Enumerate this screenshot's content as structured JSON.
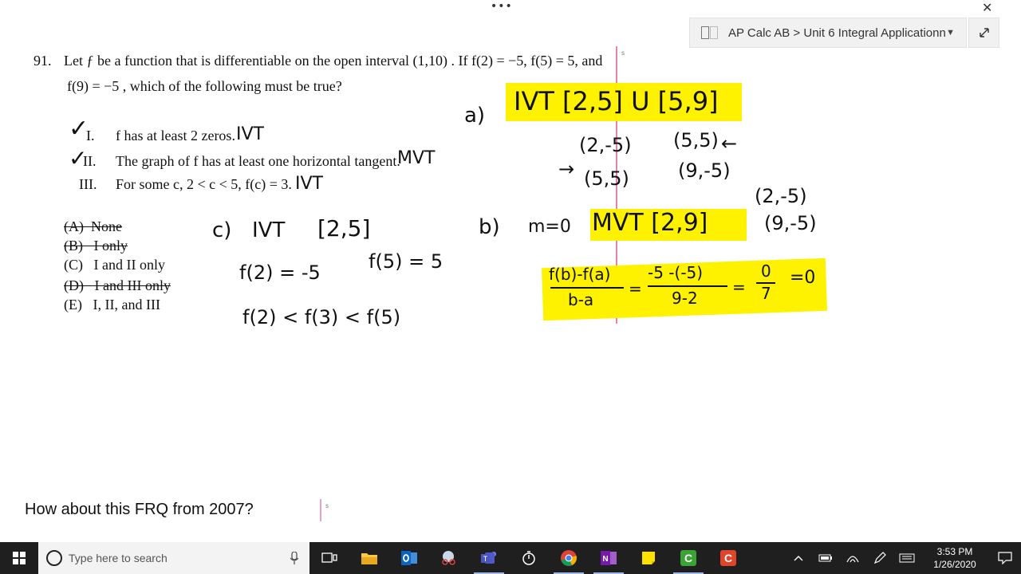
{
  "window": {
    "menu_dots": "•••",
    "close": "✕",
    "notebook_path": "AP Calc AB > Unit 6 Integral Applicationn",
    "margin_mark": "s"
  },
  "problem": {
    "number": "91.",
    "line1": "Let ƒ be a function that is differentiable on the open interval (1,10) . If f(2) = −5, f(5) = 5, and",
    "line2": "f(9) = −5 , which of the following must be true?",
    "statements": [
      {
        "check": "✓",
        "numeral": "I.",
        "text": "f has at least 2 zeros.",
        "note": "IVT"
      },
      {
        "check": "✓",
        "numeral": "II.",
        "text": "The graph of f has at least one horizontal tangent.",
        "note": "MVT"
      },
      {
        "check": "",
        "numeral": "III.",
        "text": "For some c,  2 < c < 5,  f(c) = 3.",
        "note": "IVT"
      }
    ],
    "choices": [
      {
        "letter": "(A)",
        "text": "None",
        "struck": true
      },
      {
        "letter": "(B)",
        "text": "I only",
        "struck": true
      },
      {
        "letter": "(C)",
        "text": "I and II only",
        "struck": false
      },
      {
        "letter": "(D)",
        "text": "I and III only",
        "struck": true
      },
      {
        "letter": "(E)",
        "text": "I, II, and III",
        "struck": false
      }
    ]
  },
  "handwriting": {
    "a_label": "a)",
    "a_highlight": "IVT  [2,5] U [5,9]",
    "a_pt1": "(2,-5)",
    "a_pt2": "(5,5)",
    "a_pt3": "(5,5)",
    "a_pt4": "(9,-5)",
    "arrow_left": "←",
    "arrow_right": "→",
    "b_label": "b)",
    "b_m": "m=0",
    "b_highlight": "MVT [2,9]",
    "b_pt1": "(2,-5)",
    "b_pt2": "(9,-5)",
    "b_frac_num": "f(b)-f(a)",
    "b_frac_den": "b-a",
    "b_eq": "=",
    "b_frac2_num": "-5 -(-5)",
    "b_frac2_den": "9-2",
    "b_eq2": "=",
    "b_frac3_num": "0",
    "b_frac3_den": "7",
    "b_result": "=0",
    "c_label": "c)",
    "c_ivt": "IVT",
    "c_interval": "[2,5]",
    "c_line2a": "f(2) = -5",
    "c_line2b": "f(5) = 5",
    "c_line3": "f(2) < f(3) < f(5)"
  },
  "prompt_text": "How about this FRQ from 2007?",
  "taskbar": {
    "search_placeholder": "Type here to search",
    "time": "3:53 PM",
    "date": "1/26/2020"
  }
}
